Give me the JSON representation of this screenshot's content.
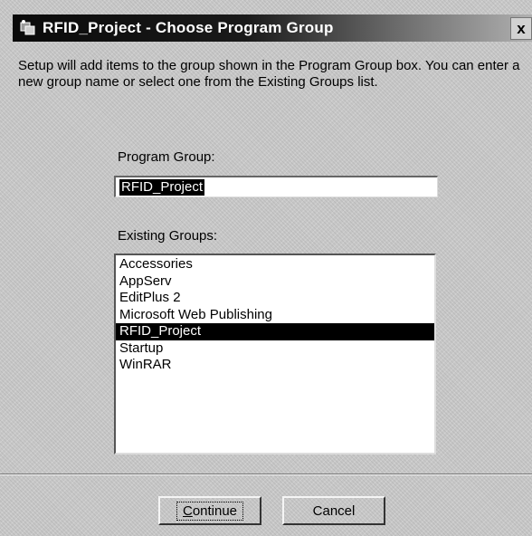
{
  "window": {
    "title": "RFID_Project - Choose Program Group",
    "close_symbol": "x",
    "title_icon": "setup-icon"
  },
  "intro": {
    "text": "Setup will add items to the group shown in the Program Group box. You can enter a new group name or select one from the Existing Groups list."
  },
  "program_group": {
    "label": "Program Group:",
    "value": "RFID_Project"
  },
  "existing_groups": {
    "label": "Existing Groups:",
    "items": [
      {
        "label": "Accessories",
        "selected": false
      },
      {
        "label": "AppServ",
        "selected": false
      },
      {
        "label": "EditPlus 2",
        "selected": false
      },
      {
        "label": "Microsoft Web Publishing",
        "selected": false
      },
      {
        "label": "RFID_Project",
        "selected": true
      },
      {
        "label": "Startup",
        "selected": false
      },
      {
        "label": "WinRAR",
        "selected": false
      }
    ]
  },
  "buttons": {
    "continue_label": "Continue",
    "cancel_label": "Cancel"
  },
  "colors": {
    "title_bar": "#0a0a0a",
    "selection": "#000000",
    "dialog_face": "#c8c8c8"
  }
}
